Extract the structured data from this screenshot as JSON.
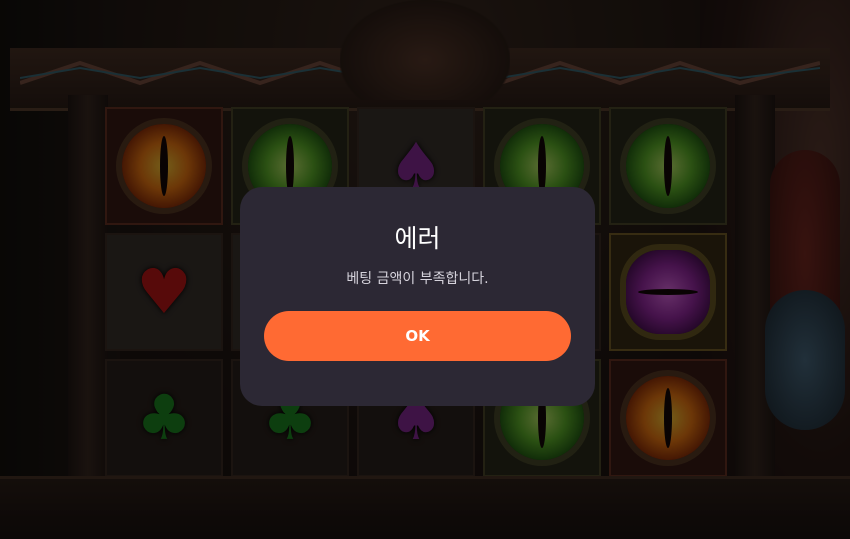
{
  "dialog": {
    "title": "에러",
    "message": "베팅 금액이 부족합니다.",
    "ok_label": "OK"
  },
  "colors": {
    "modal_bg": "#2c2834",
    "ok_button": "#ff6a33",
    "title_text": "#ffffff",
    "message_text": "#d6d3dc"
  },
  "reels": {
    "symbols": [
      [
        "orange-eye",
        "heart",
        "club"
      ],
      [
        "green-eye",
        "blank",
        "club"
      ],
      [
        "spade",
        "blank",
        "spade"
      ],
      [
        "green-eye",
        "blank",
        "green-eye"
      ],
      [
        "green-eye",
        "purple-eye",
        "orange-eye"
      ]
    ]
  }
}
